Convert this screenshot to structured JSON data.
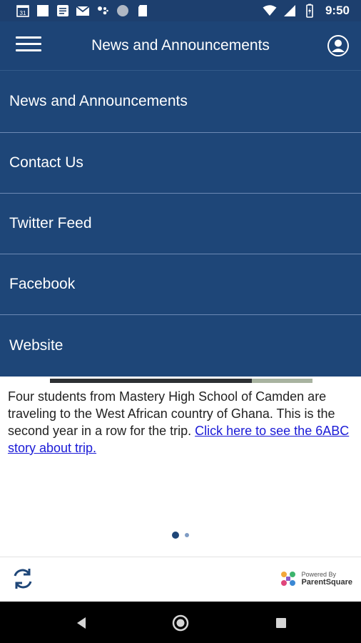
{
  "status_bar": {
    "time": "9:50",
    "left_icons": [
      "calendar-icon",
      "square-icon",
      "news-icon",
      "gmail-icon",
      "assistant-icon",
      "circle-icon",
      "sd-card-icon"
    ],
    "right_icons": [
      "wifi-icon",
      "signal-icon",
      "battery-icon"
    ],
    "calendar_day": "31"
  },
  "app_bar": {
    "title": "News and Announcements",
    "menu_icon": "hamburger-icon",
    "account_icon": "account-icon"
  },
  "menu": {
    "items": [
      {
        "label": "News and Announcements"
      },
      {
        "label": "Contact Us"
      },
      {
        "label": "Twitter Feed"
      },
      {
        "label": "Facebook"
      },
      {
        "label": "Website"
      }
    ]
  },
  "article": {
    "text": "Four students from Mastery High School of Camden are traveling to the West African country of Ghana. This is the second year in a row for the trip. ",
    "link_text": "Click here to see the 6ABC story about trip."
  },
  "pager": {
    "current": 1,
    "total": 2
  },
  "bottom_bar": {
    "refresh_icon": "refresh-icon",
    "powered_by": "Powered By",
    "brand": "ParentSquare"
  },
  "colors": {
    "app_bar": "#1d4476",
    "menu": "#1e4678",
    "link": "#1a1ad6"
  }
}
